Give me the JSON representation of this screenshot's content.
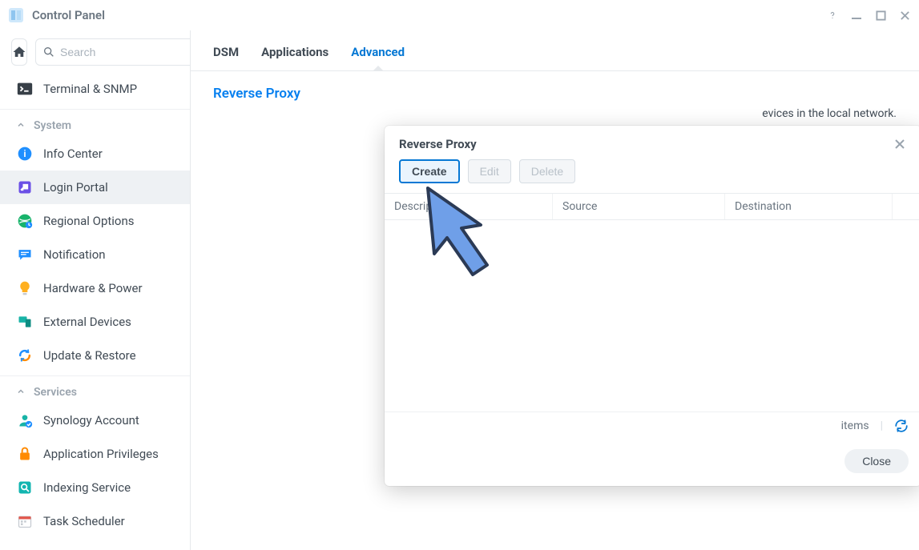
{
  "window": {
    "title": "Control Panel"
  },
  "sidebar": {
    "searchPlaceholder": "Search",
    "items": [
      {
        "label": "Terminal & SNMP"
      }
    ],
    "sections": [
      {
        "title": "System",
        "items": [
          {
            "label": "Info Center"
          },
          {
            "label": "Login Portal",
            "active": true
          },
          {
            "label": "Regional Options"
          },
          {
            "label": "Notification"
          },
          {
            "label": "Hardware & Power"
          },
          {
            "label": "External Devices"
          },
          {
            "label": "Update & Restore"
          }
        ]
      },
      {
        "title": "Services",
        "items": [
          {
            "label": "Synology Account"
          },
          {
            "label": "Application Privileges"
          },
          {
            "label": "Indexing Service"
          },
          {
            "label": "Task Scheduler"
          }
        ]
      }
    ]
  },
  "tabs": {
    "items": [
      {
        "label": "DSM"
      },
      {
        "label": "Applications"
      },
      {
        "label": "Advanced",
        "active": true
      }
    ]
  },
  "page": {
    "sectionTitle": "Reverse Proxy",
    "descriptionTail": "evices in the local network."
  },
  "modal": {
    "title": "Reverse Proxy",
    "buttons": {
      "create": "Create",
      "edit": "Edit",
      "delete": "Delete",
      "close": "Close"
    },
    "columns": {
      "description": "Description",
      "source": "Source",
      "destination": "Destination"
    },
    "status": {
      "items": "items"
    }
  }
}
